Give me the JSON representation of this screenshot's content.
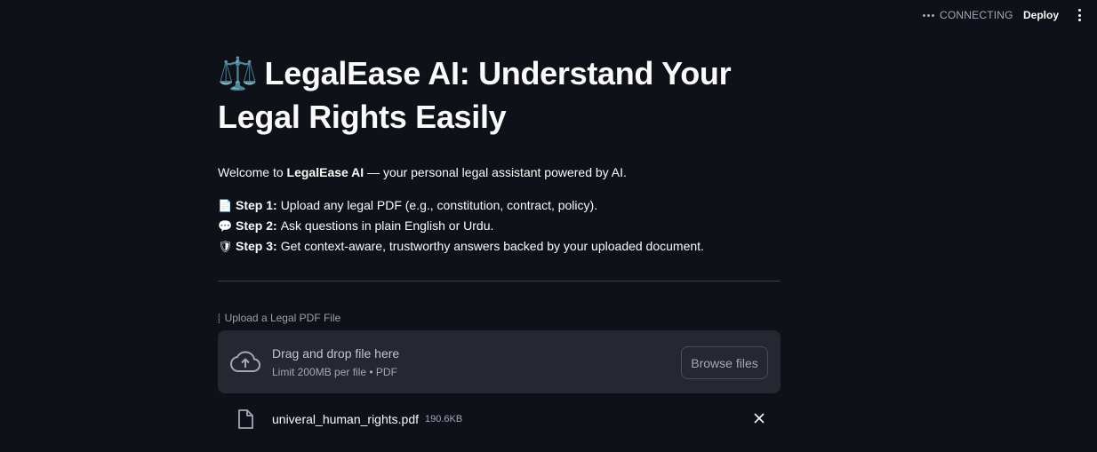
{
  "header": {
    "status": "CONNECTING",
    "deploy_label": "Deploy",
    "menu_icon": "kebab-menu-icon"
  },
  "main": {
    "title_icon": "⚖️",
    "title": "LegalEase AI: Understand Your Legal Rights Easily",
    "welcome_prefix": "Welcome to ",
    "welcome_brand": "LegalEase AI",
    "welcome_suffix": " — your personal legal assistant powered by AI.",
    "steps": [
      {
        "icon": "📄",
        "label": "Step 1:",
        "text": "Upload any legal PDF (e.g., constitution, contract, policy)."
      },
      {
        "icon": "💬",
        "label": "Step 2:",
        "text": "Ask questions in plain English or Urdu."
      },
      {
        "icon": "🛡",
        "label": "Step 3:",
        "text": "Get context-aware, trustworthy answers backed by your uploaded document."
      }
    ]
  },
  "uploader": {
    "label": "Upload a Legal PDF File",
    "drop_title": "Drag and drop file here",
    "drop_subtitle": "Limit 200MB per file • PDF",
    "browse_label": "Browse files",
    "file": {
      "name": "univeral_human_rights.pdf",
      "size": "190.6KB"
    }
  },
  "colors": {
    "background": "#0e1117",
    "surface": "#262730",
    "text": "#fafafa",
    "muted": "#a3a8b8"
  }
}
